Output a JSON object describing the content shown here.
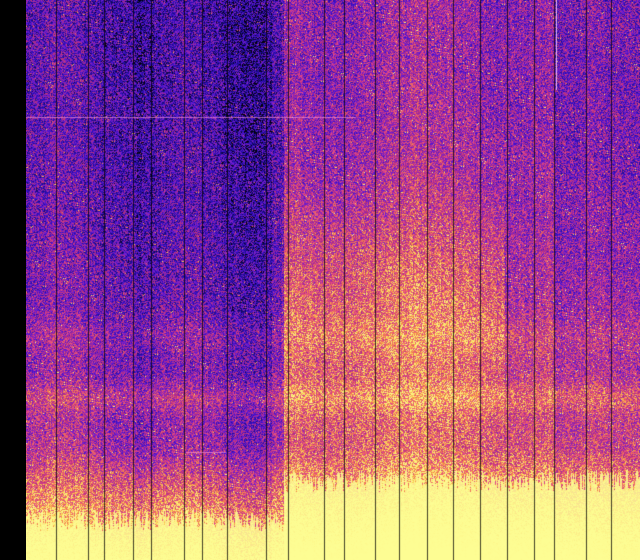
{
  "image": {
    "kind": "spectrogram",
    "colormap": [
      "#000004",
      "#1b0c8a",
      "#3a10c8",
      "#7a1fd0",
      "#b5307a",
      "#e0458f",
      "#f37a4a",
      "#fbd85a",
      "#fcfb8c"
    ],
    "background_color": "#000000",
    "low_color": "#1f0fa8",
    "high_color": "#fdfd94",
    "line_color": "#000000"
  }
}
